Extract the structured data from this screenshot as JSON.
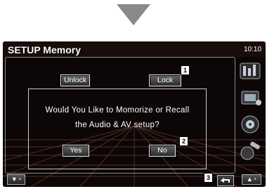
{
  "header": {
    "title": "SETUP Memory",
    "clock": "10:10"
  },
  "buttons": {
    "unlock": "Unlock",
    "lock": "Lock",
    "yes": "Yes",
    "no": "No"
  },
  "dialog": {
    "line1": "Would You Like to Momorize or Recall",
    "line2": "the Audio & AV setup?"
  },
  "callouts": [
    "1",
    "2",
    "3"
  ],
  "bottom": {
    "left_icon": "volume-down-icon",
    "right_icon": "volume-up-icon",
    "return_icon": "return-icon"
  },
  "side_icons": [
    "audio-menu-icon",
    "setup-menu-icon",
    "video-menu-icon",
    "tools-menu-icon"
  ]
}
